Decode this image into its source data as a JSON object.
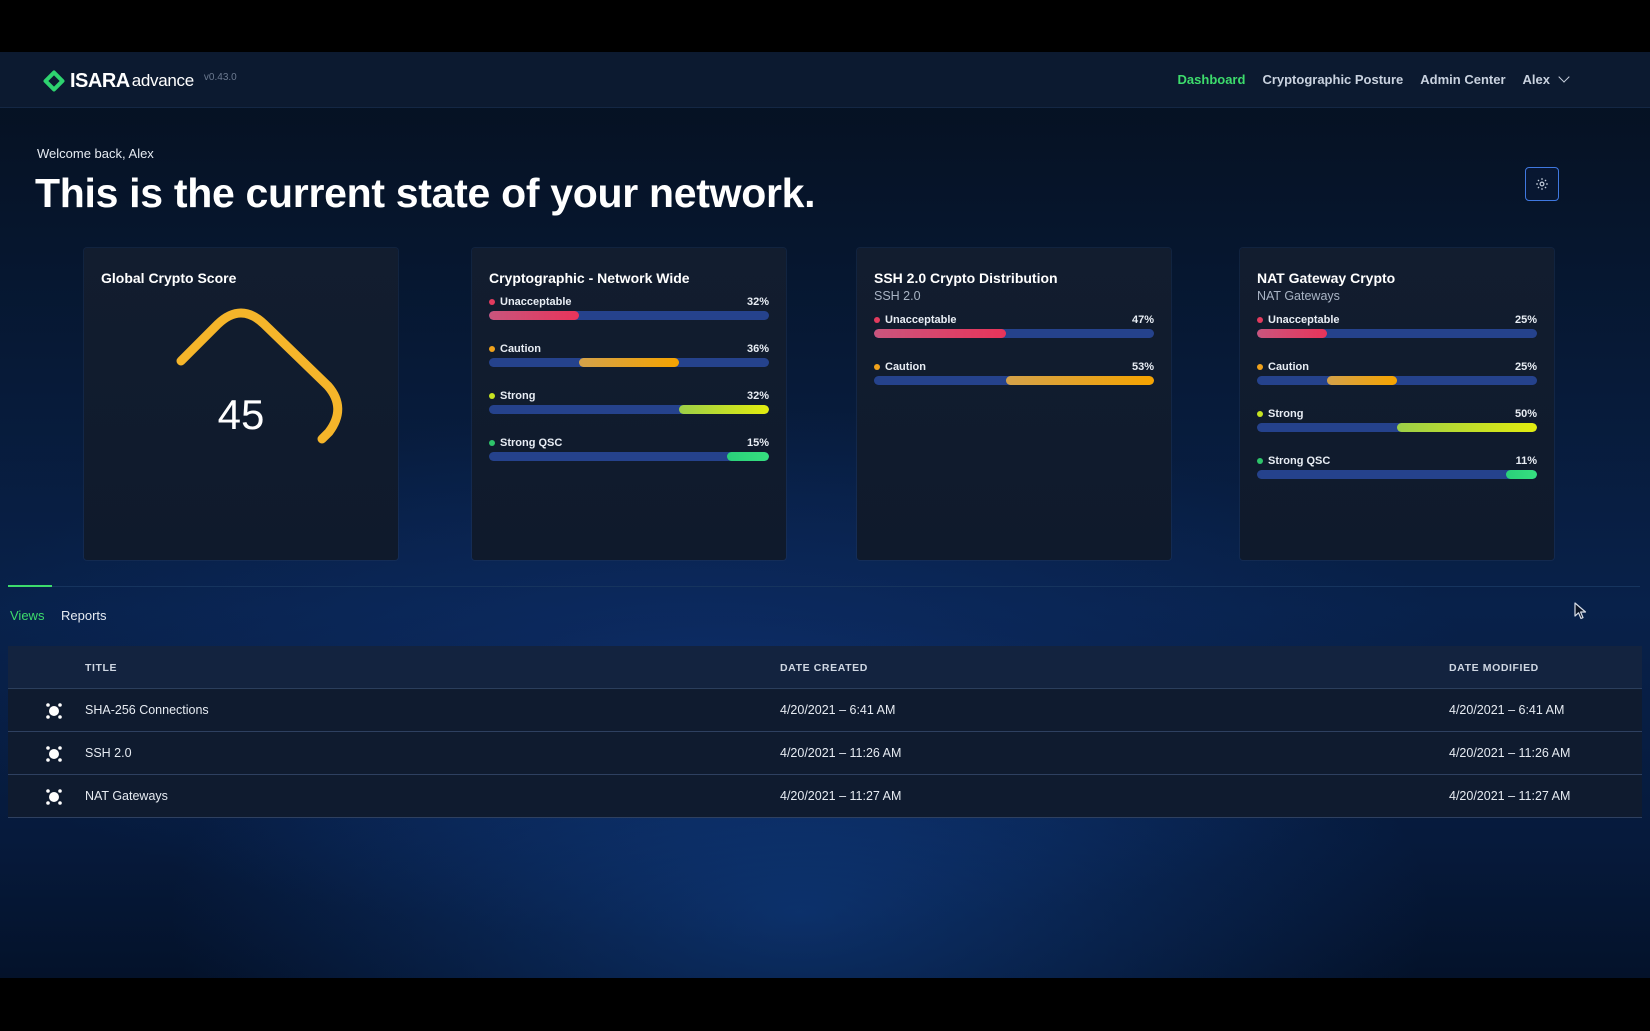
{
  "header": {
    "brand_bold": "ISARA",
    "brand_light": "advance",
    "version": "v0.43.0",
    "nav": [
      {
        "label": "Dashboard",
        "active": true
      },
      {
        "label": "Cryptographic Posture",
        "active": false
      },
      {
        "label": "Admin Center",
        "active": false
      }
    ],
    "user": "Alex"
  },
  "hero": {
    "welcome": "Welcome back, Alex",
    "headline": "This is the current state of your network."
  },
  "cards": {
    "score": {
      "title": "Global Crypto Score",
      "value": "45",
      "score": 45,
      "color": "#f5b52a"
    },
    "network": {
      "title": "Cryptographic - Network Wide",
      "bars": [
        {
          "label": "Unacceptable",
          "pct": "32%",
          "value": 32,
          "dot": "#e23b5e"
        },
        {
          "label": "Caution",
          "pct": "36%",
          "value": 36,
          "dot": "#f0a21c"
        },
        {
          "label": "Strong",
          "pct": "32%",
          "value": 32,
          "dot": "#c6e321"
        },
        {
          "label": "Strong QSC",
          "pct": "15%",
          "value": 15,
          "dot": "#2ec46a"
        }
      ]
    },
    "ssh": {
      "title": "SSH 2.0 Crypto Distribution",
      "subtitle": "SSH 2.0",
      "bars": [
        {
          "label": "Unacceptable",
          "pct": "47%",
          "value": 47,
          "dot": "#e23b5e"
        },
        {
          "label": "Caution",
          "pct": "53%",
          "value": 53,
          "dot": "#f0a21c"
        }
      ]
    },
    "nat": {
      "title": "NAT Gateway Crypto",
      "subtitle": "NAT Gateways",
      "bars": [
        {
          "label": "Unacceptable",
          "pct": "25%",
          "value": 25,
          "dot": "#e23b5e"
        },
        {
          "label": "Caution",
          "pct": "25%",
          "value": 25,
          "dot": "#f0a21c"
        },
        {
          "label": "Strong",
          "pct": "50%",
          "value": 50,
          "dot": "#c6e321"
        },
        {
          "label": "Strong QSC",
          "pct": "11%",
          "value": 11,
          "dot": "#2ec46a"
        }
      ]
    }
  },
  "tabs": {
    "views": "Views",
    "reports": "Reports"
  },
  "table": {
    "headers": {
      "title": "TITLE",
      "created": "DATE CREATED",
      "modified": "DATE MODIFIED"
    },
    "rows": [
      {
        "title": "SHA-256 Connections",
        "created": "4/20/2021 – 6:41 AM",
        "modified": "4/20/2021 – 6:41 AM"
      },
      {
        "title": "SSH 2.0",
        "created": "4/20/2021 – 11:26 AM",
        "modified": "4/20/2021 – 11:26 AM"
      },
      {
        "title": "NAT Gateways",
        "created": "4/20/2021 – 11:27 AM",
        "modified": "4/20/2021 – 11:27 AM"
      }
    ]
  },
  "colors": {
    "accent": "#3ddc6c",
    "track": "#25428c",
    "unacceptable": "#e23b5e",
    "caution": "#f0a21c",
    "strong": "#c6e321",
    "strong_qsc": "#2ec46a"
  }
}
